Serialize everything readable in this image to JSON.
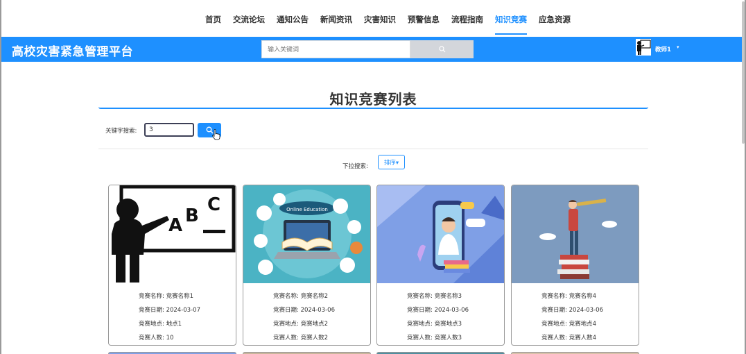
{
  "nav": {
    "items": [
      {
        "label": "首页"
      },
      {
        "label": "交流论坛"
      },
      {
        "label": "通知公告"
      },
      {
        "label": "新闻资讯"
      },
      {
        "label": "灾害知识"
      },
      {
        "label": "预警信息"
      },
      {
        "label": "流程指南"
      },
      {
        "label": "知识竞赛"
      },
      {
        "label": "应急资源"
      }
    ],
    "active_index": 7
  },
  "header": {
    "brand": "高校灾害紧急管理平台",
    "search_placeholder": "输入关键词",
    "user_name": "教师1",
    "caret": "▾"
  },
  "main": {
    "title": "知识竞赛列表",
    "keyword_label": "关键字搜索:",
    "keyword_value": "3",
    "dropdown_label": "下拉搜索:",
    "sort_label": "排序▾"
  },
  "cards": [
    {
      "name_label": "竞赛名称:",
      "name": "竞赛名称1",
      "date_label": "竞赛日期:",
      "date": "2024-03-07",
      "place_label": "竞赛地点:",
      "place": "地点1",
      "count_label": "竞赛人数:",
      "count": "10"
    },
    {
      "name_label": "竞赛名称:",
      "name": "竞赛名称2",
      "date_label": "竞赛日期:",
      "date": "2024-03-06",
      "place_label": "竞赛地点:",
      "place": "竞赛地点2",
      "count_label": "竞赛人数:",
      "count": "竞赛人数2"
    },
    {
      "name_label": "竞赛名称:",
      "name": "竞赛名称3",
      "date_label": "竞赛日期:",
      "date": "2024-03-06",
      "place_label": "竞赛地点:",
      "place": "竞赛地点3",
      "count_label": "竞赛人数:",
      "count": "竞赛人数3"
    },
    {
      "name_label": "竞赛名称:",
      "name": "竞赛名称4",
      "date_label": "竞赛日期:",
      "date": "2024-03-06",
      "place_label": "竞赛地点:",
      "place": "竞赛地点4",
      "count_label": "竞赛人数:",
      "count": "竞赛人数4"
    }
  ],
  "card_images": {
    "1": {
      "letters": [
        "A",
        "B",
        "C"
      ]
    },
    "2": {
      "banner": "Online Education"
    }
  },
  "colors": {
    "primary": "#1e90ff",
    "search_button": "#d3d6db"
  }
}
